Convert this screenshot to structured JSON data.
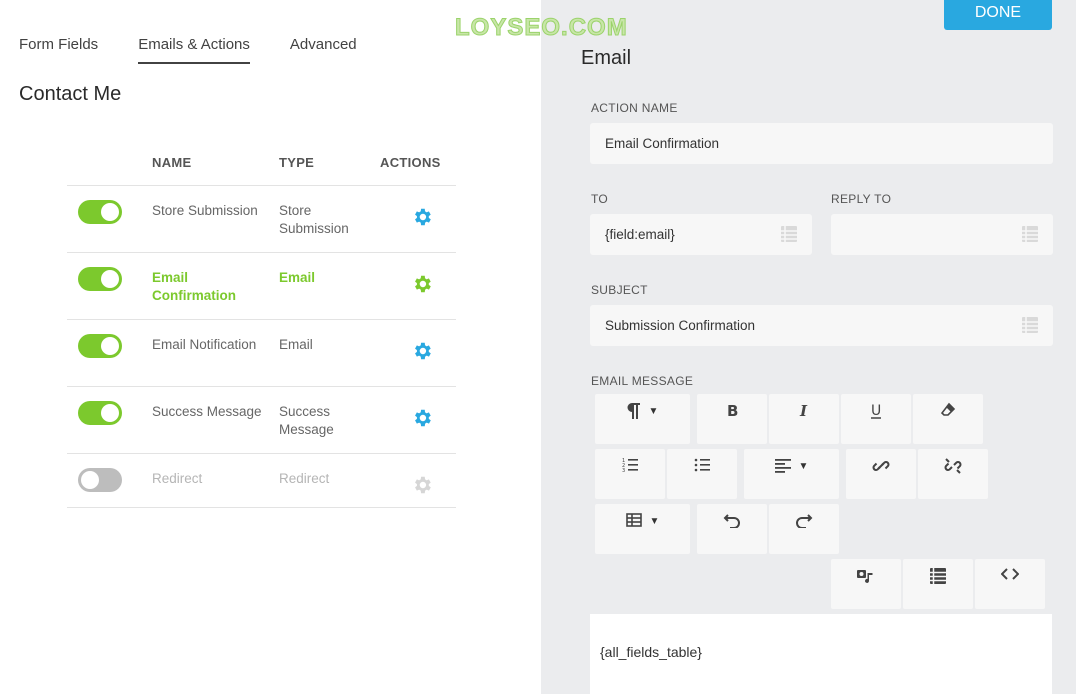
{
  "tabs": [
    "Form Fields",
    "Emails & Actions",
    "Advanced"
  ],
  "form_title": "Contact Me",
  "table": {
    "headers": {
      "name": "NAME",
      "type": "TYPE",
      "actions": "ACTIONS"
    },
    "rows": [
      {
        "name": "Store Submission",
        "type": "Store Submission",
        "enabled": true,
        "state": "normal"
      },
      {
        "name": "Email Confirmation",
        "type": "Email",
        "enabled": true,
        "state": "active"
      },
      {
        "name": "Email Notification",
        "type": "Email",
        "enabled": true,
        "state": "normal"
      },
      {
        "name": "Success Message",
        "type": "Success Message",
        "enabled": true,
        "state": "normal"
      },
      {
        "name": "Redirect",
        "type": "Redirect",
        "enabled": false,
        "state": "disabled"
      }
    ]
  },
  "done_label": "DONE",
  "watermark": "LOYSEO.COM",
  "panel": {
    "title": "Email",
    "action_name_label": "ACTION NAME",
    "action_name_value": "Email Confirmation",
    "to_label": "TO",
    "to_value": "{field:email}",
    "reply_to_label": "REPLY TO",
    "reply_to_value": "",
    "subject_label": "SUBJECT",
    "subject_value": "Submission Confirmation",
    "message_label": "EMAIL MESSAGE",
    "message_value": "{all_fields_table}"
  },
  "colors": {
    "accent_green": "#7cc92d",
    "accent_blue": "#29a8e0",
    "muted": "#c4c4c4"
  }
}
